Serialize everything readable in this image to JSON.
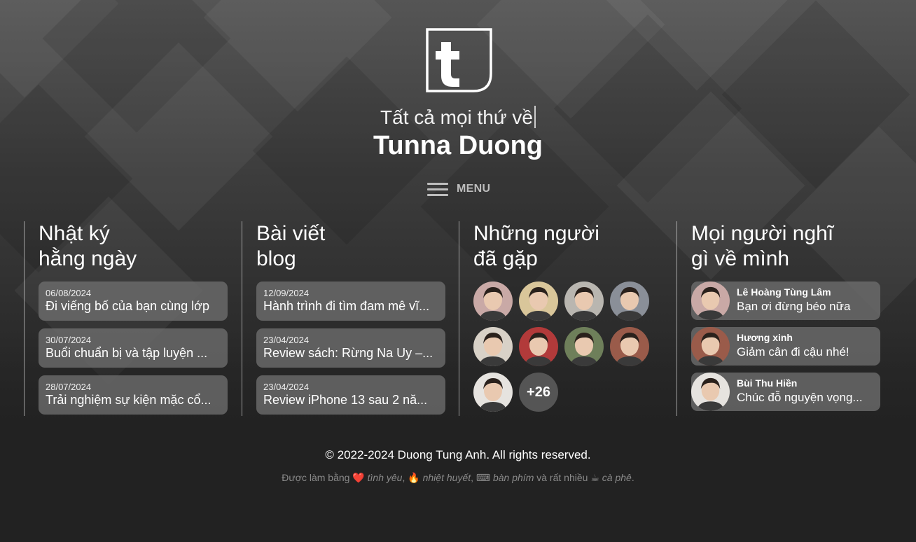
{
  "header": {
    "tagline": "Tất cả mọi thứ về",
    "name": "Tunna Duong",
    "menu_label": "MENU"
  },
  "diary": {
    "title_line1": "Nhật ký",
    "title_line2": "hằng ngày",
    "items": [
      {
        "date": "06/08/2024",
        "title": "Đi viếng bố của bạn cùng lớp"
      },
      {
        "date": "30/07/2024",
        "title": "Buổi chuẩn bị và tập luyện ..."
      },
      {
        "date": "28/07/2024",
        "title": "Trải nghiệm sự kiện mặc cổ..."
      }
    ]
  },
  "blog": {
    "title_line1": "Bài viết",
    "title_line2": "blog",
    "items": [
      {
        "date": "12/09/2024",
        "title": "Hành trình đi tìm đam mê vĩ..."
      },
      {
        "date": "23/04/2024",
        "title": "Review sách: Rừng Na Uy –..."
      },
      {
        "date": "23/04/2024",
        "title": "Review iPhone 13 sau 2 nă..."
      }
    ]
  },
  "people": {
    "title_line1": "Những người",
    "title_line2": "đã gặp",
    "more_count": "+26",
    "avatar_colors": [
      "#c9a9a6",
      "#d9c69a",
      "#b9b6b0",
      "#8a8f98",
      "#d8d1c7",
      "#b23a3a",
      "#6e7f5a",
      "#9a5b4a",
      "#e6e3df"
    ]
  },
  "reviews": {
    "title_line1": "Mọi người nghĩ",
    "title_line2": "gì về mình",
    "items": [
      {
        "name": "Lê Hoàng Tùng Lâm",
        "message": "Bạn ơi đừng béo nữa"
      },
      {
        "name": "Hương xinh",
        "message": "Giảm cân đi cậu nhé!"
      },
      {
        "name": "Bùi Thu Hiền",
        "message": "Chúc đỗ nguyện vọng..."
      }
    ]
  },
  "footer": {
    "copyright": "© 2022-2024 Duong Tung Anh. All rights reserved.",
    "made_prefix": "Được làm bằng",
    "love_emoji": "❤️",
    "love": "tình yêu",
    "fire_emoji": "🔥",
    "passion": "nhiệt huyết",
    "keyboard_emoji": "⌨",
    "keyboard": "bàn phím",
    "and_many": "và rất nhiều",
    "coffee_emoji": "☕",
    "coffee": "cà phê"
  }
}
